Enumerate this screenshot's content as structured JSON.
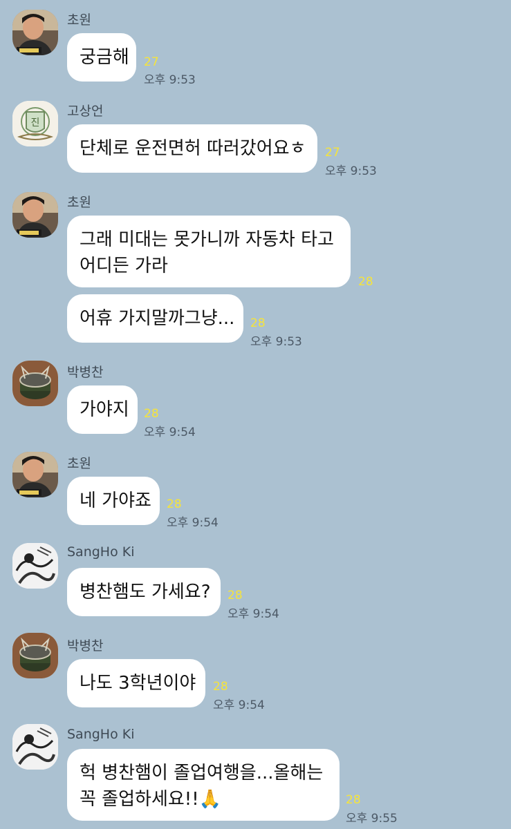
{
  "messages": [
    {
      "sender": "초원",
      "text": "궁금해",
      "unread": "27",
      "time": "오후 9:53"
    },
    {
      "sender": "고상언",
      "text": "단체로 운전면허 따러갔어요ㅎ",
      "unread": "27",
      "time": "오후 9:53"
    },
    {
      "sender": "초원",
      "lines": [
        "그래 미대는 못가니까 자동차 타고",
        "어디든 가라"
      ],
      "unread": "28"
    },
    {
      "text": "어휴 가지말까그냥...",
      "unread": "28",
      "time": "오후 9:53"
    },
    {
      "sender": "박병찬",
      "text": "가야지",
      "unread": "28",
      "time": "오후 9:54"
    },
    {
      "sender": "초원",
      "text": "네 가야죠",
      "unread": "28",
      "time": "오후 9:54"
    },
    {
      "sender": "SangHo Ki",
      "text": "병찬햄도 가세요?",
      "unread": "28",
      "time": "오후 9:54"
    },
    {
      "sender": "박병찬",
      "text": "나도 3학년이야",
      "unread": "28",
      "time": "오후 9:54"
    },
    {
      "sender": "SangHo Ki",
      "lines": [
        "헉 병찬햄이 졸업여행을...올해는",
        "꼭 졸업하세요!!🙏"
      ],
      "unread": "28",
      "time": "오후 9:55"
    }
  ],
  "icons": {
    "choweon": "person-photo-avatar",
    "gosangeon": "emblem-avatar",
    "parkbyeongchan": "metal-object-avatar",
    "sangho": "sketch-art-avatar"
  }
}
